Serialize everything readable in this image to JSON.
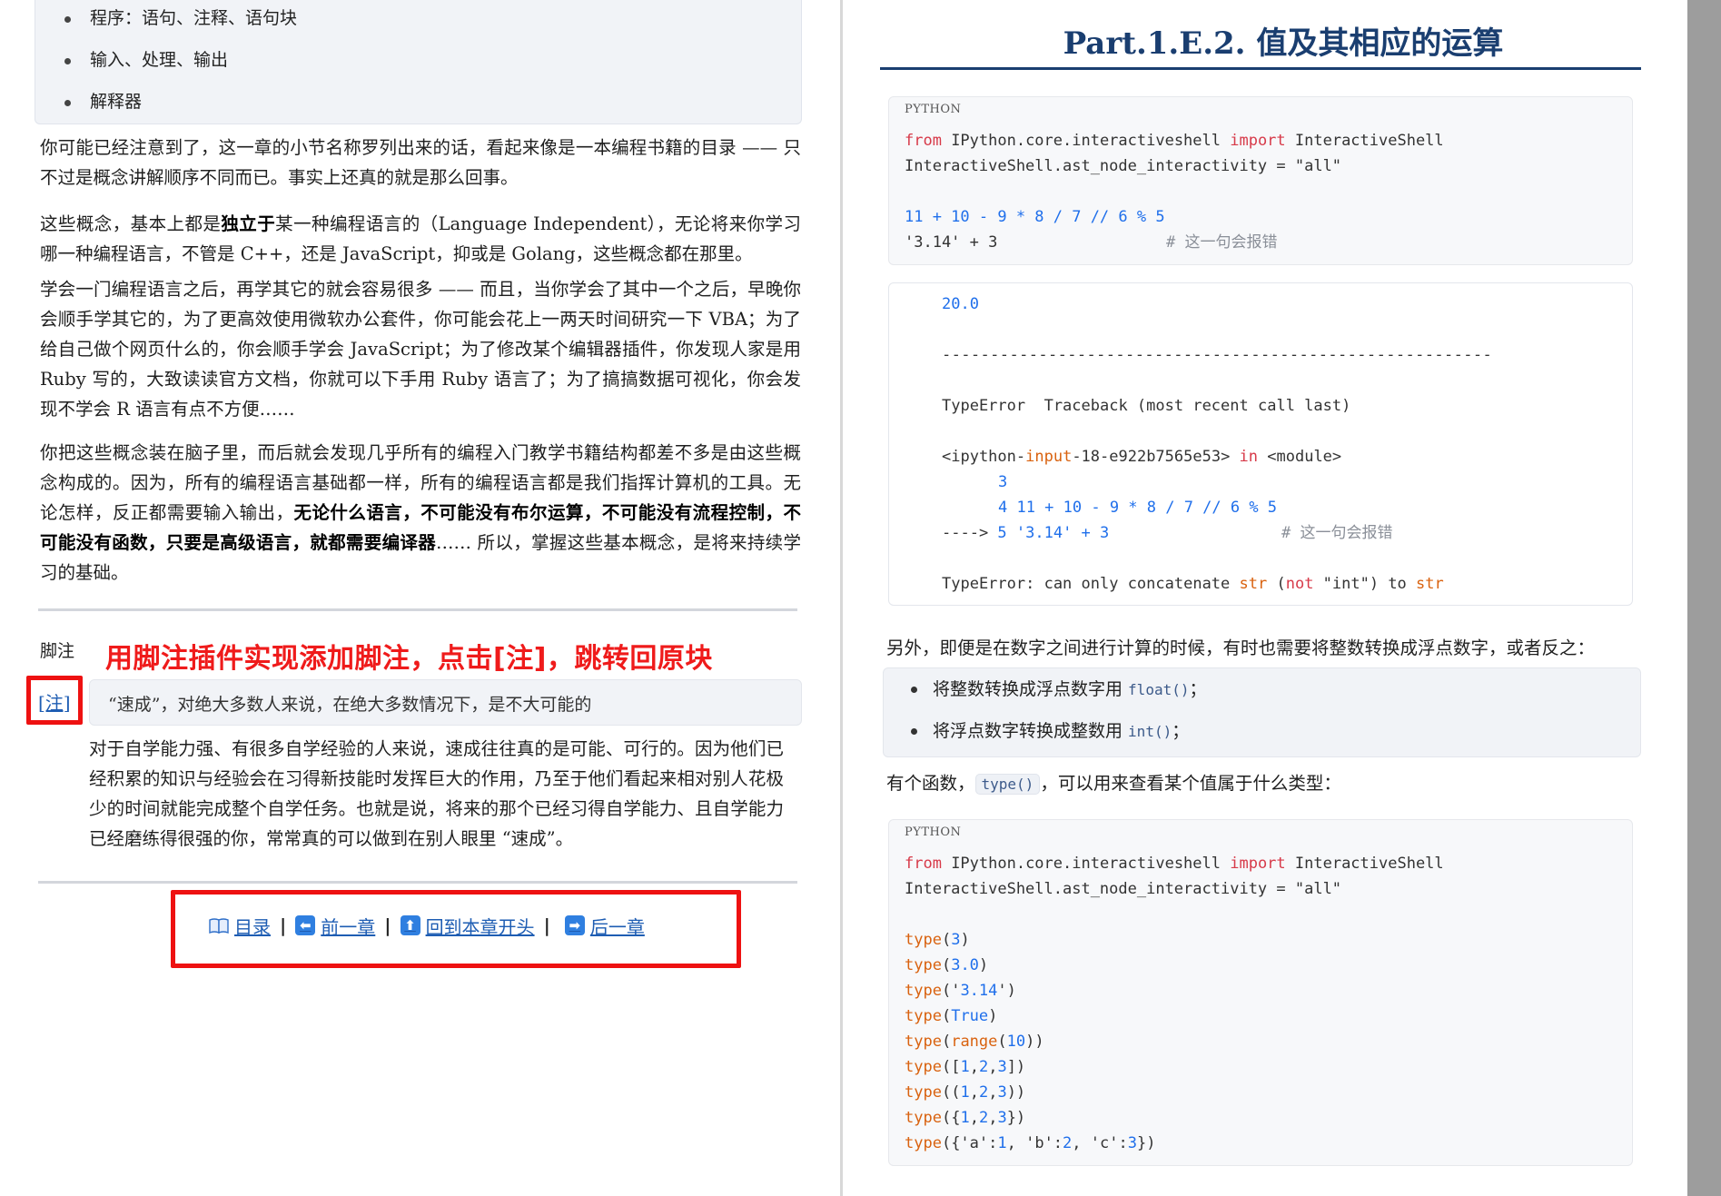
{
  "left": {
    "toc_items": [
      "程序：语句、注释、语句块",
      "输入、处理、输出",
      "解释器"
    ],
    "para1": "你可能已经注意到了，这一章的小节名称罗列出来的话，看起来像是一本编程书籍的目录 —— 只不过是概念讲解顺序不同而已。事实上还真的就是那么回事。",
    "para2_pre": "这些概念，基本上都是",
    "para2_bold": "独立于",
    "para2_post": "某一种编程语言的（Language Independent），无论将来你学习哪一种编程语言，不管是 C++，还是 JavaScript，抑或是 Golang，这些概念都在那里。",
    "para3": "学会一门编程语言之后，再学其它的就会容易很多 —— 而且，当你学会了其中一个之后，早晚你会顺手学其它的，为了更高效使用微软办公套件，你可能会花上一两天时间研究一下 VBA；为了给自己做个网页什么的，你会顺手学会 JavaScript；为了修改某个编辑器插件，你发现人家是用 Ruby 写的，大致读读官方文档，你就可以下手用 Ruby 语言了；为了搞搞数据可视化，你会发现不学会 R 语言有点不方便……",
    "para4_pre": "你把这些概念装在脑子里，而后就会发现几乎所有的编程入门教学书籍结构都差不多是由这些概念构成的。因为，所有的编程语言基础都一样，所有的编程语言都是我们指挥计算机的工具。无论怎样，反正都需要输入输出，",
    "para4_bold": "无论什么语言，不可能没有布尔运算，不可能没有流程控制，不可能没有函数，只要是高级语言，就都需要编译器",
    "para4_post": "…… 所以，掌握这些基本概念，是将来持续学习的基础。",
    "footnote_title": "脚注",
    "annotation": "用脚注插件实现添加脚注，点击[注]，跳转回原块",
    "footnote_ref": "[注]",
    "footnote_quote": "“速成”，对绝大多数人来说，在绝大多数情况下，是不大可能的",
    "footnote_body": "对于自学能力强、有很多自学经验的人来说，速成往往真的是可能、可行的。因为他们已经积累的知识与经验会在习得新技能时发挥巨大的作用，乃至于他们看起来相对别人花极少的时间就能完成整个自学任务。也就是说，将来的那个已经习得自学能力、且自学能力已经磨练得很强的你，常常真的可以做到在别人眼里 “速成”。",
    "nav": {
      "toc": "目录",
      "prev": "前一章",
      "top": "回到本章开头",
      "next": "后一章",
      "sep": "|"
    }
  },
  "right": {
    "title": "Part.1.E.2. 值及其相应的运算",
    "lang_label": "PYTHON",
    "code1": {
      "import_from": "from",
      "import_module": " IPython.core.interactiveshell ",
      "import_kw": "import",
      "import_name": " InteractiveShell",
      "setting_line": "InteractiveShell.ast_node_interactivity = \"all\"",
      "expr_line": "11 + 10 - 9 * 8 / 7 // 6 % 5",
      "error_line": "'3.14' + 3",
      "error_comment": "# 这一句会报错"
    },
    "output": {
      "result": "20.0",
      "dashes": "---------------------------------------------------------",
      "error_header": "TypeError  Traceback (most recent call last)",
      "location_pre": "<ipython-",
      "location_input": "input",
      "location_mid": "-18-e922b7565e53> ",
      "location_in": "in",
      "location_post": " <module>",
      "tb_line3": "3",
      "tb_line4": "4 11 + 10 - 9 * 8 / 7 // 6 % 5",
      "tb_arrow": "---->",
      "tb_line5": " 5 '3.14' + 3",
      "tb_comment": "# 这一句会报错",
      "final_pre": "TypeError: can only concatenate ",
      "final_str1": "str",
      "final_mid1": " (",
      "final_not": "not",
      "final_mid2": " \"int\") to ",
      "final_str2": "str"
    },
    "para_convert": "另外，即便是在数字之间进行计算的时候，有时也需要将整数转换成浮点数字，或者反之：",
    "convert_items": [
      {
        "text": "将整数转换成浮点数字用 ",
        "code": "float()",
        "tail": "；"
      },
      {
        "text": "将浮点数字转换成整数用 ",
        "code": "int()",
        "tail": "；"
      }
    ],
    "para_type_pre": "有个函数，",
    "para_type_code": "type()",
    "para_type_post": "，可以用来查看某个值属于什么类型：",
    "code2": {
      "type_fn": "type",
      "range_fn": "range",
      "calls": [
        "(3)",
        "(3.0)",
        "('3.14')",
        "(True)",
        "(range(10))",
        "([1,2,3])",
        "((1,2,3))",
        "({1,2,3})",
        "({'a':1, 'b':2, 'c':3})"
      ]
    }
  },
  "colors": {
    "annotation_red": "#ef1b1b",
    "title_navy": "#1a3e70",
    "link_blue": "#1e5db3",
    "keyword_red": "#d73a49",
    "number_blue": "#1f6feb",
    "builtin_orange": "#d9620f"
  }
}
